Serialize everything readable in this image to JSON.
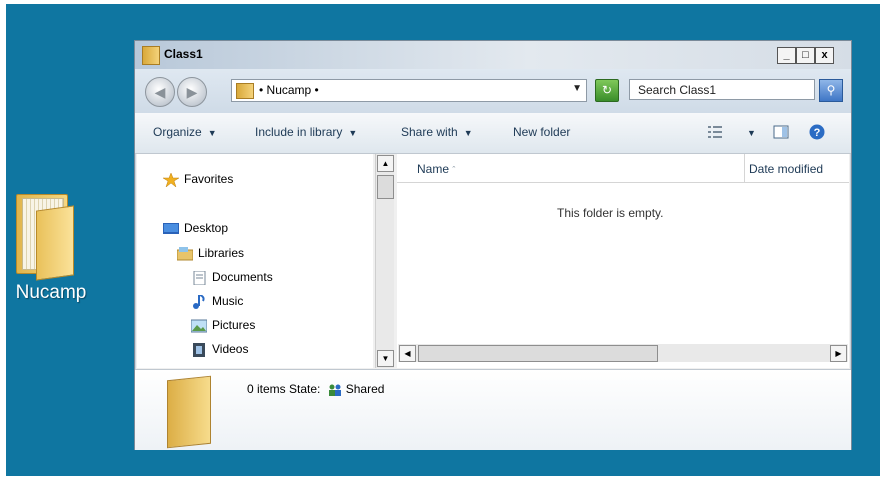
{
  "desktop": {
    "icon_label": "Nucamp",
    "background_color": "#0f76a1"
  },
  "window": {
    "title": "Class1",
    "controls": {
      "minimize": "_",
      "maximize": "□",
      "close": "x"
    }
  },
  "navbar": {
    "back_icon": "back-arrow-icon",
    "forward_icon": "forward-arrow-icon",
    "breadcrumb": "• Nucamp •",
    "search_placeholder": "Search Class1"
  },
  "toolbar": {
    "organize": "Organize",
    "include_in_library": "Include in library",
    "share_with": "Share with",
    "new_folder": "New folder"
  },
  "nav_pane": {
    "favorites": "Favorites",
    "desktop": "Desktop",
    "libraries": "Libraries",
    "documents": "Documents",
    "music": "Music",
    "pictures": "Pictures",
    "videos": "Videos"
  },
  "content": {
    "col_name": "Name",
    "col_date": "Date modified",
    "empty_message": "This folder is empty."
  },
  "details": {
    "items": "0 items",
    "state_label": "State:",
    "state_value": "Shared"
  }
}
